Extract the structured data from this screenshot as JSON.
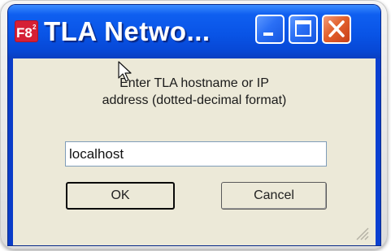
{
  "window": {
    "title": "TLA Netwo...",
    "app_icon": "tla-app-icon"
  },
  "titlebar_buttons": {
    "minimize_icon": "minimize-icon",
    "maximize_icon": "maximize-icon",
    "close_icon": "close-icon"
  },
  "dialog": {
    "prompt_line1": "Enter TLA hostname or IP",
    "prompt_line2": "address (dotted-decimal format)",
    "host_value": "localhost",
    "ok_label": "OK",
    "cancel_label": "Cancel"
  },
  "colors": {
    "titlebar": "#0954e6",
    "close_button": "#e2602c",
    "client_bg": "#ece9d8"
  }
}
